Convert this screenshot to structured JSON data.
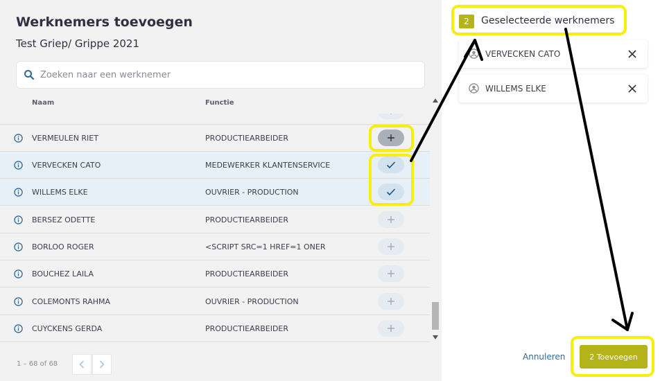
{
  "dialog": {
    "title": "Werknemers toevoegen",
    "subtitle": "Test Griep/ Grippe 2021"
  },
  "search": {
    "placeholder": "Zoeken naar een werknemer",
    "value": ""
  },
  "table": {
    "headers": {
      "name": "Naam",
      "function": "Functie"
    },
    "rows": [
      {
        "name": "VERMEULEN RIET",
        "function": "PRODUCTIEARBEIDER",
        "state": "hover"
      },
      {
        "name": "VERVECKEN CATO",
        "function": "MEDEWERKER KLANTENSERVICE",
        "state": "selected"
      },
      {
        "name": "WILLEMS ELKE",
        "function": "OUVRIER - PRODUCTION",
        "state": "selected"
      },
      {
        "name": "BERSEZ ODETTE",
        "function": "PRODUCTIEARBEIDER",
        "state": "add"
      },
      {
        "name": "BORLOO ROGER",
        "function": "<SCRIPT SRC=1 HREF=1 ONER",
        "state": "add"
      },
      {
        "name": "BOUCHEZ LAILA",
        "function": "PRODUCTIEARBEIDER",
        "state": "add"
      },
      {
        "name": "COLEMONTS RAHMA",
        "function": "OUVRIER - PRODUCTION",
        "state": "add"
      },
      {
        "name": "CUYCKENS GERDA",
        "function": "PRODUCTIEARBEIDER",
        "state": "add"
      }
    ]
  },
  "pager": {
    "range": "1 – 68 of 68"
  },
  "selected_panel": {
    "count": "2",
    "heading": "Geselecteerde werknemers",
    "items": [
      "VERVECKEN CATO",
      "WILLEMS ELKE"
    ]
  },
  "footer": {
    "cancel_label": "Annuleren",
    "add_label": "2 Toevoegen"
  },
  "icons": {
    "search": "search-icon",
    "info": "info-icon",
    "add": "plus-icon",
    "selected": "check-icon",
    "avatar": "user-circle-icon",
    "remove": "close-icon",
    "prev": "chevron-left-icon",
    "next": "chevron-right-icon"
  },
  "colors": {
    "accent": "#b4b41a",
    "link": "#2d6a9f",
    "highlight_annotation": "#f7ee10",
    "selected_row": "#e8f0f7"
  }
}
